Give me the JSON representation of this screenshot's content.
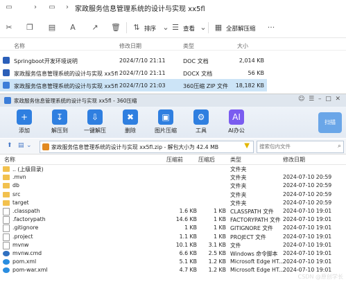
{
  "explorer": {
    "address_path": "家政服务信息管理系统的设计与实现 xx5fl",
    "toolbar": {
      "sort_label": "排序",
      "view_label": "查看",
      "extract_all_label": "全部解压缩"
    },
    "headers": [
      "名称",
      "修改日期",
      "类型",
      "大小"
    ],
    "rows": [
      {
        "name": "Springboot开发环境说明",
        "date": "2024/7/10 21:11",
        "type": "DOC 文档",
        "size": "2,014 KB"
      },
      {
        "name": "家政服务信息管理系统的设计与实现 xx5fl",
        "date": "2024/7/10 21:11",
        "type": "DOCX 文档",
        "size": "56 KB"
      },
      {
        "name": "家政服务信息管理系统的设计与实现 xx5fl",
        "date": "2024/7/10 21:03",
        "type": "360压缩 ZIP 文件",
        "size": "18,182 KB"
      }
    ]
  },
  "zipwin": {
    "title": "家政服务信息管理系统的设计与实现 xx5fl - 360压缩",
    "tools": [
      {
        "label": "添加",
        "icon": "add-icon",
        "color": "#2f7fe0"
      },
      {
        "label": "解压到",
        "icon": "extract-to-icon",
        "color": "#2f7fe0"
      },
      {
        "label": "一键解压",
        "icon": "one-click-extract-icon",
        "color": "#2f7fe0"
      },
      {
        "label": "删除",
        "icon": "delete-icon",
        "color": "#2f7fe0"
      },
      {
        "label": "图片压缩",
        "icon": "image-compress-icon",
        "color": "#2f7fe0"
      },
      {
        "label": "工具",
        "icon": "tools-icon",
        "color": "#2f7fe0"
      },
      {
        "label": "AI办公",
        "icon": "ai-office-icon",
        "color": "#7a5cf0"
      }
    ],
    "scan_label": "扫描",
    "path_text": "家政服务信息管理系统的设计与实现 xx5fl.zip - 解包大小为 42.4 MB",
    "search_placeholder": "搜索包内文件",
    "headers": [
      "名称",
      "压缩前",
      "压缩后",
      "类型",
      "修改日期"
    ],
    "rows": [
      {
        "name": ".. (上级目录)",
        "before": "",
        "after": "",
        "type": "文件夹",
        "date": "",
        "kind": "folder"
      },
      {
        "name": ".mvn",
        "before": "",
        "after": "",
        "type": "文件夹",
        "date": "2024-07-10 20:59",
        "kind": "folder"
      },
      {
        "name": "db",
        "before": "",
        "after": "",
        "type": "文件夹",
        "date": "2024-07-10 20:59",
        "kind": "folder"
      },
      {
        "name": "src",
        "before": "",
        "after": "",
        "type": "文件夹",
        "date": "2024-07-10 20:59",
        "kind": "folder"
      },
      {
        "name": "target",
        "before": "",
        "after": "",
        "type": "文件夹",
        "date": "2024-07-10 20:59",
        "kind": "folder"
      },
      {
        "name": ".classpath",
        "before": "1.6 KB",
        "after": "1 KB",
        "type": "CLASSPATH 文件",
        "date": "2024-07-10 19:01",
        "kind": "doc"
      },
      {
        "name": ".factorypath",
        "before": "14.6 KB",
        "after": "1 KB",
        "type": "FACTORYPATH 文件",
        "date": "2024-07-10 19:01",
        "kind": "doc"
      },
      {
        "name": ".gitignore",
        "before": "1 KB",
        "after": "1 KB",
        "type": "GITIGNORE 文件",
        "date": "2024-07-10 19:01",
        "kind": "doc"
      },
      {
        "name": ".project",
        "before": "1.1 KB",
        "after": "1 KB",
        "type": "PROJECT 文件",
        "date": "2024-07-10 19:01",
        "kind": "doc"
      },
      {
        "name": "mvnw",
        "before": "10.1 KB",
        "after": "3.1 KB",
        "type": "文件",
        "date": "2024-07-10 19:01",
        "kind": "doc"
      },
      {
        "name": "mvnw.cmd",
        "before": "6.6 KB",
        "after": "2.5 KB",
        "type": "Windows 命令脚本",
        "date": "2024-07-10 19:01",
        "kind": "app"
      },
      {
        "name": "pom.xml",
        "before": "5.1 KB",
        "after": "1.2 KB",
        "type": "Microsoft Edge HT...",
        "date": "2024-07-10 19:01",
        "kind": "edge"
      },
      {
        "name": "pom-war.xml",
        "before": "4.7 KB",
        "after": "1.2 KB",
        "type": "Microsoft Edge HT...",
        "date": "2024-07-10 19:01",
        "kind": "edge"
      }
    ]
  },
  "watermark": "CSDN @原创学长"
}
